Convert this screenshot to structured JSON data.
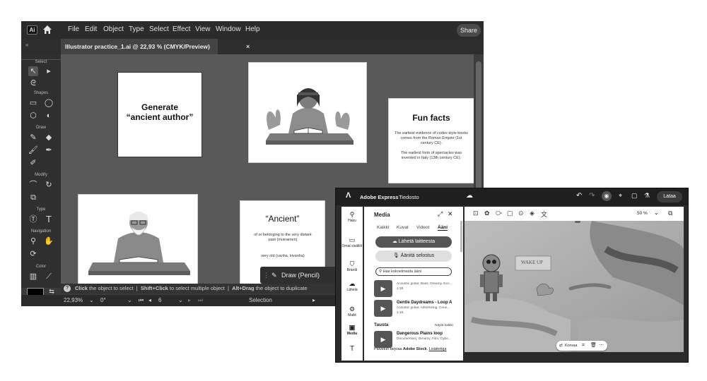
{
  "illustrator": {
    "logo": "Ai",
    "home_icon": "home-icon",
    "menu": [
      "File",
      "Edit",
      "Object",
      "Type",
      "Select",
      "Effect",
      "View",
      "Window",
      "Help"
    ],
    "share": "Share",
    "tab_title": "Illustrator practice_1.ai @ 22,93 % (CMYK/Preview)",
    "tab_close": "×",
    "tool_sections": [
      "Select",
      "Shapes",
      "Draw",
      "Modify",
      "Type",
      "Navigation",
      "Color"
    ],
    "artboards": {
      "generate": "Generate\n“ancient author”",
      "fun_facts_title": "Fun facts",
      "fun_facts_p1": "The earliest evidence of codex-style books comes from the Roman Empire (1st century CE).",
      "fun_facts_p2": "The earliest form of spectacles was invented in Italy (13th century CE).",
      "ancient_title": "“Ancient”",
      "ancient_p1": "of or belonging to the very distant past (muinainen)",
      "ancient_p2": "very old (vanha, kivanha)"
    },
    "draw_panel_label": "Draw (Pencil)",
    "status_hint": {
      "q": "?",
      "part1_bold": "Click",
      "part1": " the object to select",
      "part2_bold": "Shift+Click",
      "part2": " to select multiple object",
      "part3_bold": "Alt+Drag",
      "part3": " the object to duplicate"
    },
    "bottom_bar": {
      "zoom": "22,93%",
      "rotation": "0°",
      "artboard_number": "6",
      "mode": "Selection"
    }
  },
  "express": {
    "app_name": "Adobe Express",
    "file_menu": "Tiedosto",
    "download_button": "Lataa",
    "rail": [
      {
        "icon": "search-icon",
        "label": "Haku"
      },
      {
        "icon": "folder-icon",
        "label": "Omat sisällöt"
      },
      {
        "icon": "brand-icon",
        "label": "Brändi"
      },
      {
        "icon": "upload-icon",
        "label": "Lähetä"
      },
      {
        "icon": "templates-icon",
        "label": "Mallit"
      },
      {
        "icon": "media-icon",
        "label": "Media"
      },
      {
        "icon": "text-icon",
        "label": "T"
      }
    ],
    "panel": {
      "title": "Media",
      "tabs": [
        "Kaikki",
        "Kuvat",
        "Videot",
        "Ääni"
      ],
      "active_tab": "Ääni",
      "upload_button": "Lähetä laitteesta",
      "record_button": "Äänitä selostus",
      "search_placeholder": "Hae kokoelmasta ääni",
      "items": [
        {
          "title": "",
          "tags": "Acoustic guitar, Bass, Dreamy, Exo...",
          "duration": "1:28"
        },
        {
          "title": "Gentle Daydreams - Loop A",
          "tags": "Acoustic guitar, Advertising, Coun...",
          "duration": "1:15"
        }
      ],
      "section_title": "Tausta",
      "section_link": "Näytä kaikki",
      "background_item": {
        "title": "Dangerous Plains loop",
        "tags": "Documentary, Dreamy, Film, Cybe..."
      },
      "footer_prefix": "Palvelun tarjoaa ",
      "footer_brand": "Adobe Stock",
      "footer_link": "Lisätietoja"
    },
    "zoom": "50 %",
    "canvas_sign": "WAKE UP",
    "context_toolbar": {
      "replace": "Korvaa"
    }
  }
}
